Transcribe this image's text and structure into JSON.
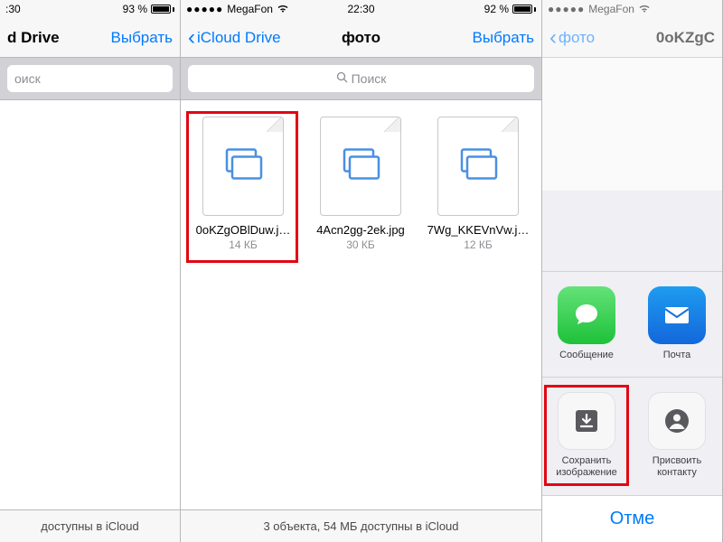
{
  "s1": {
    "status": {
      "battery_pct": "93 %",
      "time_suffix": ":30"
    },
    "nav": {
      "title_suffix": "d Drive",
      "action": "Выбрать"
    },
    "search": {
      "placeholder_suffix": "оиск"
    },
    "footer_suffix": "доступны в iCloud"
  },
  "s2": {
    "status": {
      "carrier": "MegaFon",
      "time": "22:30",
      "battery_pct": "92 %"
    },
    "nav": {
      "back": "iCloud Drive",
      "title": "фото",
      "action": "Выбрать"
    },
    "search": {
      "placeholder": "Поиск"
    },
    "files": [
      {
        "name": "0oKZgOBlDuw.j…",
        "size": "14 КБ"
      },
      {
        "name": "4Acn2gg-2ek.jpg",
        "size": "30 КБ"
      },
      {
        "name": "7Wg_KKEVnVw.j…",
        "size": "12 КБ"
      }
    ],
    "footer": "3 объекта, 54 МБ доступны в iCloud"
  },
  "s3": {
    "status": {
      "carrier": "MegaFon"
    },
    "nav": {
      "back": "фото",
      "title_suffix": "0oKZgC"
    },
    "share": {
      "apps": [
        {
          "label": "Сообщение",
          "icon": "message"
        },
        {
          "label": "Почта",
          "icon": "mail"
        }
      ],
      "actions": [
        {
          "label": "Сохранить изображение",
          "icon": "save"
        },
        {
          "label": "Присвоить контакту",
          "icon": "contact"
        }
      ],
      "cancel": "Отме"
    }
  }
}
